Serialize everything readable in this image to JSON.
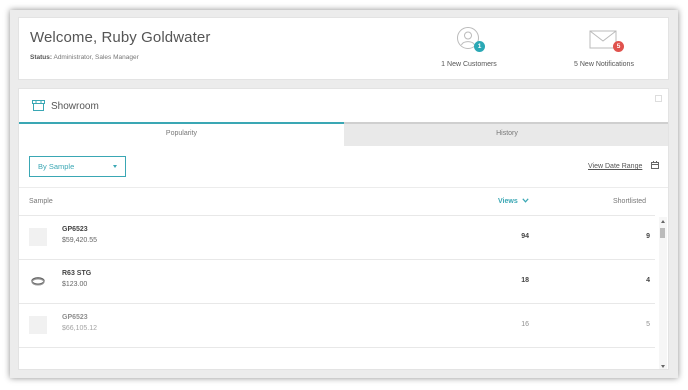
{
  "header": {
    "welcome": "Welcome, Ruby Goldwater",
    "status_label": "Status:",
    "status_value": " Administrator, Sales Manager",
    "customers": {
      "count": "1",
      "label": "1 New Customers",
      "icon": "user-icon",
      "badge_color": "#2aa8b5"
    },
    "notifications": {
      "count": "5",
      "label": "5 New Notifications",
      "icon": "envelope-icon",
      "badge_color": "#e0524d"
    }
  },
  "showroom": {
    "title": "Showroom",
    "tabs": [
      {
        "label": "Popularity",
        "active": true
      },
      {
        "label": "History",
        "active": false
      }
    ],
    "filter": {
      "selected": "By Sample"
    },
    "date_range_label": "View Date Range",
    "columns": {
      "sample": "Sample",
      "views": "Views",
      "shortlisted": "Shortlisted"
    },
    "rows": [
      {
        "name": "GP6523",
        "price": "$59,420.55",
        "views": "94",
        "shortlisted": "9"
      },
      {
        "name": "R63 STG",
        "price": "$123.00",
        "views": "18",
        "shortlisted": "4"
      },
      {
        "name": "GP6523",
        "price": "$66,105.12",
        "views": "16",
        "shortlisted": "5"
      }
    ]
  },
  "colors": {
    "accent": "#3aa7b4",
    "notification_red": "#e0524d"
  }
}
